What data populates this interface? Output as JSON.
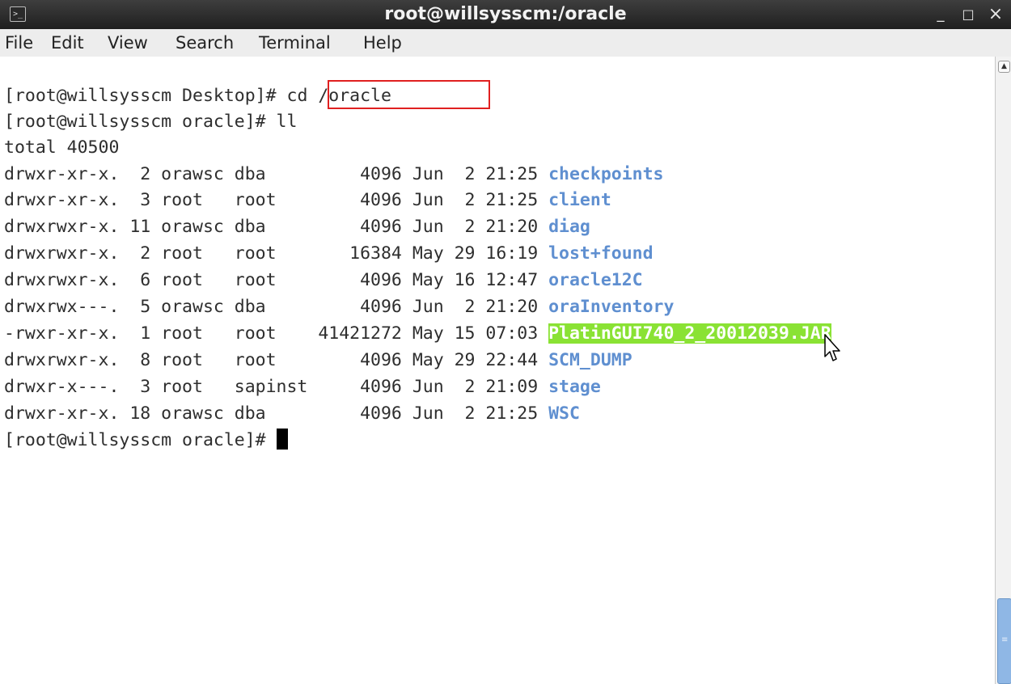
{
  "window": {
    "title": "root@willsysscm:/oracle",
    "icon": "terminal-icon",
    "controls": {
      "minimize": "_",
      "maximize": "□",
      "close": "×"
    }
  },
  "menu": {
    "file": "File",
    "edit": "Edit",
    "view": "View",
    "search": "Search",
    "terminal": "Terminal",
    "help": "Help"
  },
  "terminal": {
    "prompt1": "[root@willsysscm Desktop]# ",
    "command1": "cd /oracle",
    "prompt2": "[root@willsysscm oracle]# ",
    "command2": "ll",
    "total": "total 40500",
    "entries": [
      {
        "meta": "drwxr-xr-x.  2 orawsc dba         4096 Jun  2 21:25 ",
        "name": "checkpoints",
        "kind": "dir"
      },
      {
        "meta": "drwxr-xr-x.  3 root   root        4096 Jun  2 21:25 ",
        "name": "client",
        "kind": "dir"
      },
      {
        "meta": "drwxrwxr-x. 11 orawsc dba         4096 Jun  2 21:20 ",
        "name": "diag",
        "kind": "dir"
      },
      {
        "meta": "drwxrwxr-x.  2 root   root       16384 May 29 16:19 ",
        "name": "lost+found",
        "kind": "dir"
      },
      {
        "meta": "drwxrwxr-x.  6 root   root        4096 May 16 12:47 ",
        "name": "oracle12C",
        "kind": "dir"
      },
      {
        "meta": "drwxrwx---.  5 orawsc dba         4096 Jun  2 21:20 ",
        "name": "oraInventory",
        "kind": "dir"
      },
      {
        "meta": "-rwxr-xr-x.  1 root   root    41421272 May 15 07:03 ",
        "name": "PlatinGUI740_2_20012039.JAR",
        "kind": "exe"
      },
      {
        "meta": "drwxrwxr-x.  8 root   root        4096 May 29 22:44 ",
        "name": "SCM_DUMP",
        "kind": "dir"
      },
      {
        "meta": "drwxr-x---.  3 root   sapinst     4096 Jun  2 21:09 ",
        "name": "stage",
        "kind": "dir"
      },
      {
        "meta": "drwxr-xr-x. 18 orawsc dba         4096 Jun  2 21:25 ",
        "name": "WSC",
        "kind": "dir"
      }
    ],
    "prompt3": "[root@willsysscm oracle]# "
  },
  "colors": {
    "directory": "#5f8fd0",
    "executable_bg": "#8ae234",
    "highlight_box": "#e02020"
  }
}
